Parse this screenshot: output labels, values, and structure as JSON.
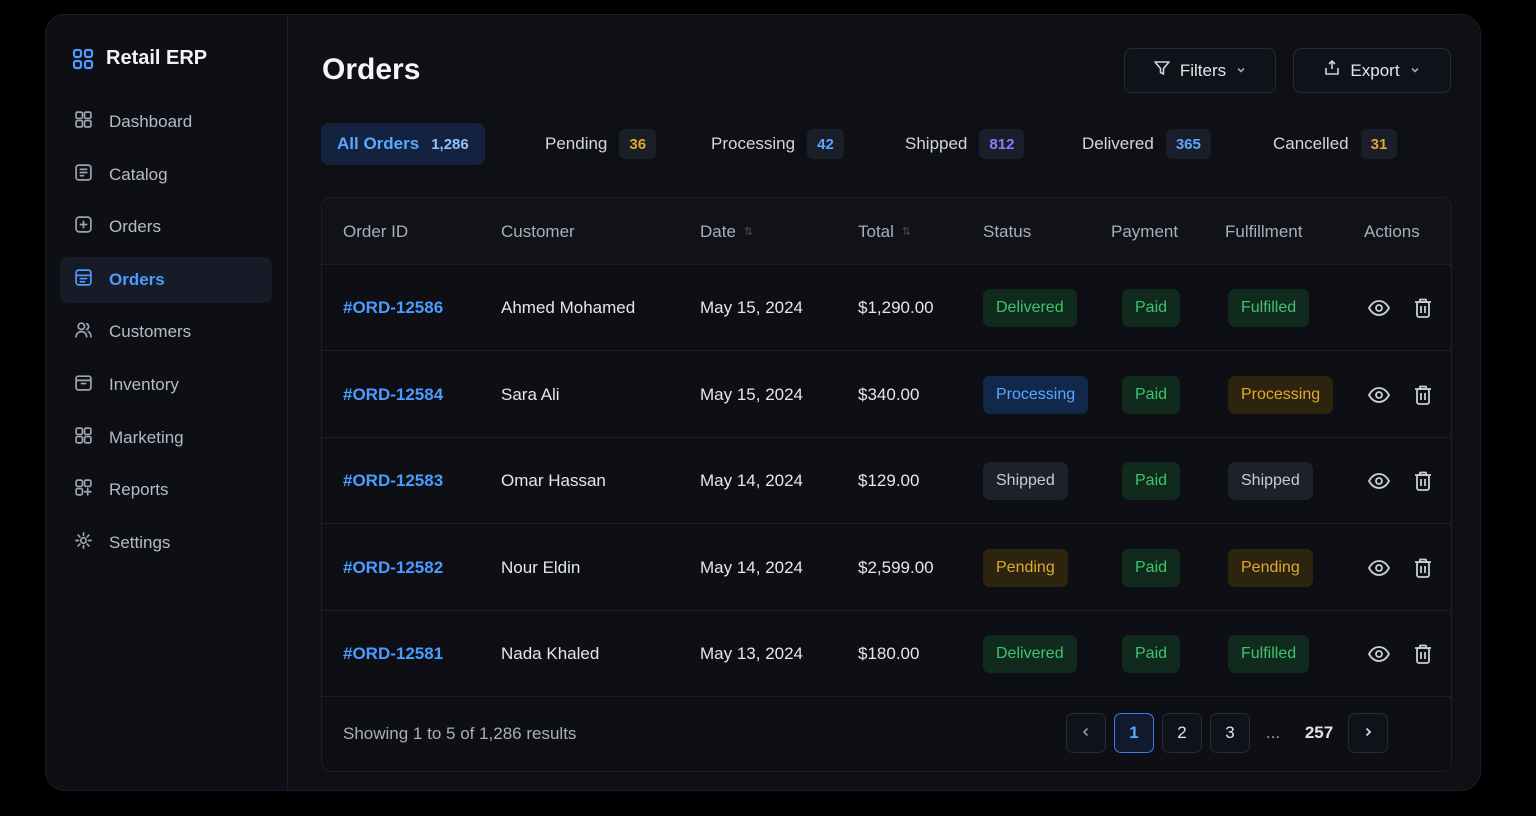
{
  "app": {
    "name": "Retail ERP"
  },
  "sidebar": {
    "items": [
      {
        "label": "Dashboard",
        "icon": "dashboard-icon",
        "active": false
      },
      {
        "label": "Catalog",
        "icon": "catalog-icon",
        "active": false
      },
      {
        "label": "Orders",
        "icon": "orders-icon",
        "active": false
      },
      {
        "label": "Orders",
        "icon": "orders-list-icon",
        "active": true
      },
      {
        "label": "Customers",
        "icon": "users-icon",
        "active": false
      },
      {
        "label": "Inventory",
        "icon": "inventory-icon",
        "active": false
      },
      {
        "label": "Marketing",
        "icon": "marketing-icon",
        "active": false
      },
      {
        "label": "Reports",
        "icon": "reports-icon",
        "active": false
      },
      {
        "label": "Settings",
        "icon": "gear-icon",
        "active": false
      }
    ]
  },
  "header": {
    "title": "Orders",
    "filters_label": "Filters",
    "export_label": "Export"
  },
  "tabs": [
    {
      "label": "All Orders",
      "count": "1,286",
      "active": true
    },
    {
      "label": "Pending",
      "count": "36",
      "count_color": "#e0a82e"
    },
    {
      "label": "Processing",
      "count": "42",
      "count_color": "#5aa7ff"
    },
    {
      "label": "Shipped",
      "count": "812",
      "count_color": "#8a7cff"
    },
    {
      "label": "Delivered",
      "count": "365",
      "count_color": "#5aa7ff"
    },
    {
      "label": "Cancelled",
      "count": "31",
      "count_color": "#e0a82e"
    }
  ],
  "table": {
    "columns": [
      "Order ID",
      "Customer",
      "Date",
      "Total",
      "Status",
      "Payment",
      "Fulfillment",
      "Actions"
    ],
    "rows": [
      {
        "order_id": "#ORD-12586",
        "customer": "Ahmed Mohamed",
        "date": "May 15, 2024",
        "total": "$1,290.00",
        "status": "Delivered",
        "status_tone": "green",
        "payment": "Paid",
        "fulfillment": "Fulfilled",
        "fulfillment_tone": "green"
      },
      {
        "order_id": "#ORD-12584",
        "customer": "Sara Ali",
        "date": "May 15, 2024",
        "total": "$340.00",
        "status": "Processing",
        "status_tone": "blue",
        "payment": "Paid",
        "fulfillment": "Processing",
        "fulfillment_tone": "amber"
      },
      {
        "order_id": "#ORD-12583",
        "customer": "Omar Hassan",
        "date": "May 14, 2024",
        "total": "$129.00",
        "status": "Shipped",
        "status_tone": "gray",
        "payment": "Paid",
        "fulfillment": "Shipped",
        "fulfillment_tone": "gray"
      },
      {
        "order_id": "#ORD-12582",
        "customer": "Nour Eldin",
        "date": "May 14, 2024",
        "total": "$2,599.00",
        "status": "Pending",
        "status_tone": "amber",
        "payment": "Paid",
        "fulfillment": "Pending",
        "fulfillment_tone": "amber"
      },
      {
        "order_id": "#ORD-12581",
        "customer": "Nada Khaled",
        "date": "May 13, 2024",
        "total": "$180.00",
        "status": "Delivered",
        "status_tone": "green",
        "payment": "Paid",
        "fulfillment": "Fulfilled",
        "fulfillment_tone": "green"
      }
    ]
  },
  "footer": {
    "summary": "Showing 1 to 5 of 1,286 results",
    "pages": [
      "1",
      "2",
      "3"
    ],
    "ellipsis": "...",
    "last_page": "257",
    "current_page": "1"
  },
  "colors": {
    "accent": "#4c9bff",
    "background": "#0e1016"
  }
}
